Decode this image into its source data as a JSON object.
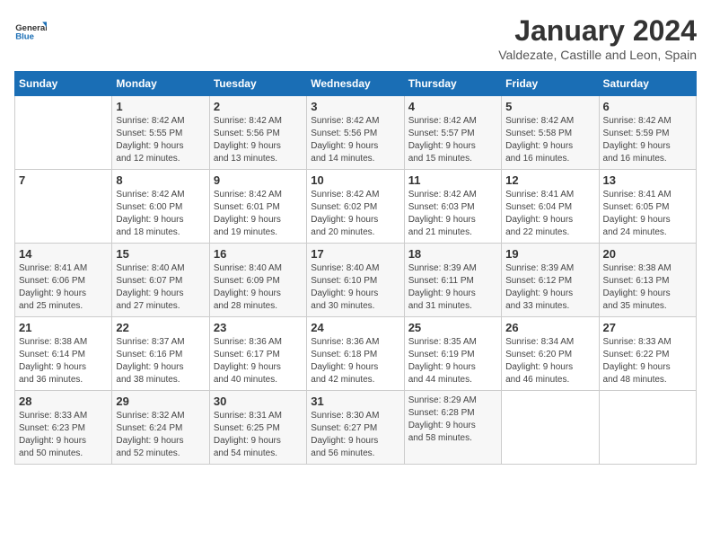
{
  "header": {
    "logo_general": "General",
    "logo_blue": "Blue",
    "month": "January 2024",
    "location": "Valdezate, Castille and Leon, Spain"
  },
  "days_of_week": [
    "Sunday",
    "Monday",
    "Tuesday",
    "Wednesday",
    "Thursday",
    "Friday",
    "Saturday"
  ],
  "weeks": [
    [
      {
        "day": "",
        "info": ""
      },
      {
        "day": "1",
        "info": "Sunrise: 8:42 AM\nSunset: 5:55 PM\nDaylight: 9 hours\nand 12 minutes."
      },
      {
        "day": "2",
        "info": "Sunrise: 8:42 AM\nSunset: 5:56 PM\nDaylight: 9 hours\nand 13 minutes."
      },
      {
        "day": "3",
        "info": "Sunrise: 8:42 AM\nSunset: 5:56 PM\nDaylight: 9 hours\nand 14 minutes."
      },
      {
        "day": "4",
        "info": "Sunrise: 8:42 AM\nSunset: 5:57 PM\nDaylight: 9 hours\nand 15 minutes."
      },
      {
        "day": "5",
        "info": "Sunrise: 8:42 AM\nSunset: 5:58 PM\nDaylight: 9 hours\nand 16 minutes."
      },
      {
        "day": "6",
        "info": "Sunrise: 8:42 AM\nSunset: 5:59 PM\nDaylight: 9 hours\nand 16 minutes."
      }
    ],
    [
      {
        "day": "7",
        "info": ""
      },
      {
        "day": "8",
        "info": "Sunrise: 8:42 AM\nSunset: 6:00 PM\nDaylight: 9 hours\nand 18 minutes."
      },
      {
        "day": "9",
        "info": "Sunrise: 8:42 AM\nSunset: 6:01 PM\nDaylight: 9 hours\nand 19 minutes."
      },
      {
        "day": "10",
        "info": "Sunrise: 8:42 AM\nSunset: 6:02 PM\nDaylight: 9 hours\nand 20 minutes."
      },
      {
        "day": "11",
        "info": "Sunrise: 8:42 AM\nSunset: 6:03 PM\nDaylight: 9 hours\nand 21 minutes."
      },
      {
        "day": "12",
        "info": "Sunrise: 8:41 AM\nSunset: 6:04 PM\nDaylight: 9 hours\nand 22 minutes."
      },
      {
        "day": "13",
        "info": "Sunrise: 8:41 AM\nSunset: 6:05 PM\nDaylight: 9 hours\nand 24 minutes."
      }
    ],
    [
      {
        "day": "14",
        "info": "Sunrise: 8:41 AM\nSunset: 6:06 PM\nDaylight: 9 hours\nand 25 minutes."
      },
      {
        "day": "15",
        "info": "Sunrise: 8:40 AM\nSunset: 6:07 PM\nDaylight: 9 hours\nand 27 minutes."
      },
      {
        "day": "16",
        "info": "Sunrise: 8:40 AM\nSunset: 6:09 PM\nDaylight: 9 hours\nand 28 minutes."
      },
      {
        "day": "17",
        "info": "Sunrise: 8:40 AM\nSunset: 6:10 PM\nDaylight: 9 hours\nand 30 minutes."
      },
      {
        "day": "18",
        "info": "Sunrise: 8:39 AM\nSunset: 6:11 PM\nDaylight: 9 hours\nand 31 minutes."
      },
      {
        "day": "19",
        "info": "Sunrise: 8:39 AM\nSunset: 6:12 PM\nDaylight: 9 hours\nand 33 minutes."
      },
      {
        "day": "20",
        "info": "Sunrise: 8:38 AM\nSunset: 6:13 PM\nDaylight: 9 hours\nand 35 minutes."
      }
    ],
    [
      {
        "day": "21",
        "info": "Sunrise: 8:38 AM\nSunset: 6:14 PM\nDaylight: 9 hours\nand 36 minutes."
      },
      {
        "day": "22",
        "info": "Sunrise: 8:37 AM\nSunset: 6:16 PM\nDaylight: 9 hours\nand 38 minutes."
      },
      {
        "day": "23",
        "info": "Sunrise: 8:36 AM\nSunset: 6:17 PM\nDaylight: 9 hours\nand 40 minutes."
      },
      {
        "day": "24",
        "info": "Sunrise: 8:36 AM\nSunset: 6:18 PM\nDaylight: 9 hours\nand 42 minutes."
      },
      {
        "day": "25",
        "info": "Sunrise: 8:35 AM\nSunset: 6:19 PM\nDaylight: 9 hours\nand 44 minutes."
      },
      {
        "day": "26",
        "info": "Sunrise: 8:34 AM\nSunset: 6:20 PM\nDaylight: 9 hours\nand 46 minutes."
      },
      {
        "day": "27",
        "info": "Sunrise: 8:33 AM\nSunset: 6:22 PM\nDaylight: 9 hours\nand 48 minutes."
      }
    ],
    [
      {
        "day": "28",
        "info": "Sunrise: 8:33 AM\nSunset: 6:23 PM\nDaylight: 9 hours\nand 50 minutes."
      },
      {
        "day": "29",
        "info": "Sunrise: 8:32 AM\nSunset: 6:24 PM\nDaylight: 9 hours\nand 52 minutes."
      },
      {
        "day": "30",
        "info": "Sunrise: 8:31 AM\nSunset: 6:25 PM\nDaylight: 9 hours\nand 54 minutes."
      },
      {
        "day": "31",
        "info": "Sunrise: 8:30 AM\nSunset: 6:27 PM\nDaylight: 9 hours\nand 56 minutes."
      },
      {
        "day": "",
        "info": "Sunrise: 8:29 AM\nSunset: 6:28 PM\nDaylight: 9 hours\nand 58 minutes."
      },
      {
        "day": "",
        "info": ""
      },
      {
        "day": "",
        "info": ""
      }
    ]
  ]
}
